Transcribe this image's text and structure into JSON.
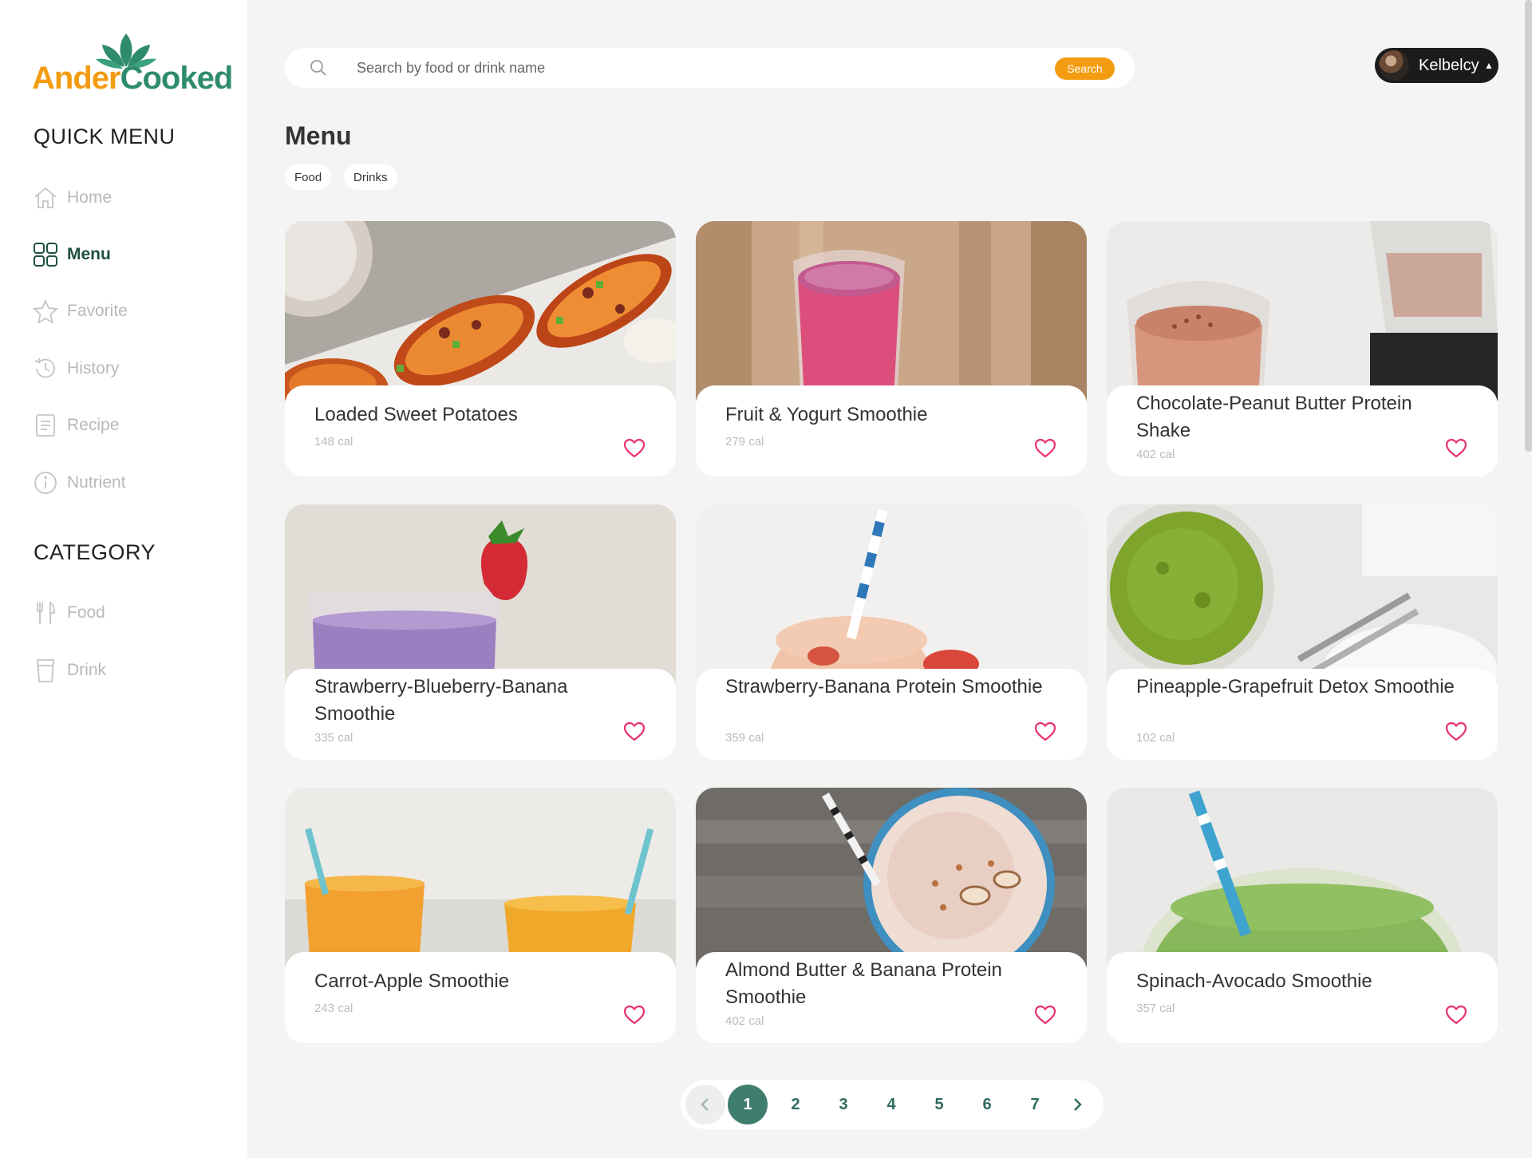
{
  "brand": {
    "part1": "Ander",
    "part2": "Cooked"
  },
  "sidebar": {
    "quick_menu_title": "QUICK MENU",
    "quick_menu": [
      {
        "label": "Home",
        "icon": "home-icon"
      },
      {
        "label": "Menu",
        "icon": "grid-icon",
        "active": true
      },
      {
        "label": "Favorite",
        "icon": "star-icon"
      },
      {
        "label": "History",
        "icon": "history-icon"
      },
      {
        "label": "Recipe",
        "icon": "document-icon"
      },
      {
        "label": "Nutrient",
        "icon": "info-icon"
      }
    ],
    "category_title": "CATEGORY",
    "categories": [
      {
        "label": "Food",
        "icon": "fork-knife-icon"
      },
      {
        "label": "Drink",
        "icon": "cup-icon"
      }
    ]
  },
  "search": {
    "placeholder": "Search by food or drink name",
    "button": "Search"
  },
  "user": {
    "name": "Kelbelcy"
  },
  "page": {
    "title": "Menu",
    "filters": [
      "Food",
      "Drinks"
    ]
  },
  "items": [
    {
      "name": "Loaded Sweet Potatoes",
      "cal": "148 cal"
    },
    {
      "name": "Fruit & Yogurt Smoothie",
      "cal": "279 cal"
    },
    {
      "name": "Chocolate-Peanut Butter Protein Shake",
      "cal": "402 cal"
    },
    {
      "name": "Strawberry-Blueberry-Banana Smoothie",
      "cal": "335 cal"
    },
    {
      "name": "Strawberry-Banana Protein Smoothie",
      "cal": "359 cal"
    },
    {
      "name": "Pineapple-Grapefruit Detox Smoothie",
      "cal": "102 cal"
    },
    {
      "name": "Carrot-Apple Smoothie",
      "cal": "243 cal"
    },
    {
      "name": "Almond Butter & Banana Protein Smoothie",
      "cal": "402 cal"
    },
    {
      "name": "Spinach-Avocado Smoothie",
      "cal": "357 cal"
    }
  ],
  "pagination": {
    "pages": [
      "1",
      "2",
      "3",
      "4",
      "5",
      "6",
      "7"
    ],
    "current": "1"
  },
  "colors": {
    "accent": "#f39c12",
    "brand_green": "#2e8b6e",
    "active_green": "#1f4f43",
    "heart": "#e8336b"
  }
}
